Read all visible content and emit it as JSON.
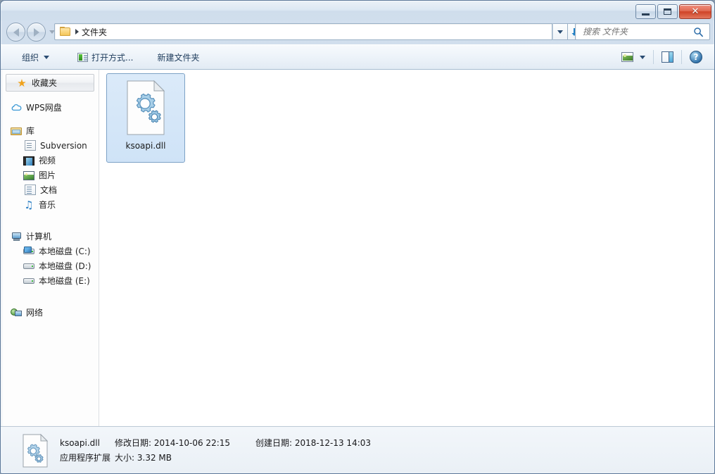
{
  "window": {
    "title": "",
    "controls": {
      "minimize": "Minimize",
      "maximize": "Maximize",
      "close": "✕"
    }
  },
  "navigation": {
    "back_tooltip": "后退",
    "forward_tooltip": "前进",
    "history_tooltip": "最近浏览的位置"
  },
  "address": {
    "folder_icon": "folder-icon",
    "separator": "▸",
    "crumb": "文件夹",
    "dropdown_icon": "chevron-down-icon",
    "refresh_icon": "refresh-icon"
  },
  "search": {
    "placeholder": "搜索 文件夹",
    "value": "",
    "icon": "search-icon"
  },
  "toolbar": {
    "organize_label": "组织",
    "open_with_label": "打开方式...",
    "new_folder_label": "新建文件夹",
    "view_icon": "view-options-icon",
    "view_chevron": "chevron-down-icon",
    "preview_pane_icon": "preview-pane-icon",
    "help_label": "?",
    "help_icon": "help-icon"
  },
  "sidebar": {
    "favorites": {
      "label": "收藏夹",
      "icon": "star-icon"
    },
    "groups": [
      {
        "label": "WPS网盘",
        "icon": "cloud-icon",
        "children": []
      },
      {
        "label": "库",
        "icon": "library-icon",
        "children": [
          {
            "label": "Subversion",
            "icon": "subversion-icon"
          },
          {
            "label": "视频",
            "icon": "video-icon"
          },
          {
            "label": "图片",
            "icon": "pictures-icon"
          },
          {
            "label": "文档",
            "icon": "documents-icon"
          },
          {
            "label": "音乐",
            "icon": "music-icon"
          }
        ]
      },
      {
        "label": "计算机",
        "icon": "computer-icon",
        "children": [
          {
            "label": "本地磁盘 (C:)",
            "icon": "system-drive-icon"
          },
          {
            "label": "本地磁盘 (D:)",
            "icon": "drive-icon"
          },
          {
            "label": "本地磁盘 (E:)",
            "icon": "drive-icon"
          }
        ]
      },
      {
        "label": "网络",
        "icon": "network-icon",
        "children": []
      }
    ]
  },
  "content": {
    "files": [
      {
        "name": "ksoapi.dll",
        "icon": "dll-gears-icon",
        "selected": true
      }
    ]
  },
  "status": {
    "icon": "dll-gears-icon",
    "file_name": "ksoapi.dll",
    "file_type": "应用程序扩展",
    "modified_label": "修改日期:",
    "modified_value": "2014-10-06 22:15",
    "created_label": "创建日期:",
    "created_value": "2018-12-13 14:03",
    "size_label": "大小:",
    "size_value": "3.32 MB"
  },
  "colors": {
    "selection": "#cfe3f7",
    "selection_border": "#7da2c6",
    "close_button": "#cf4327",
    "accent": "#2b4d73"
  }
}
